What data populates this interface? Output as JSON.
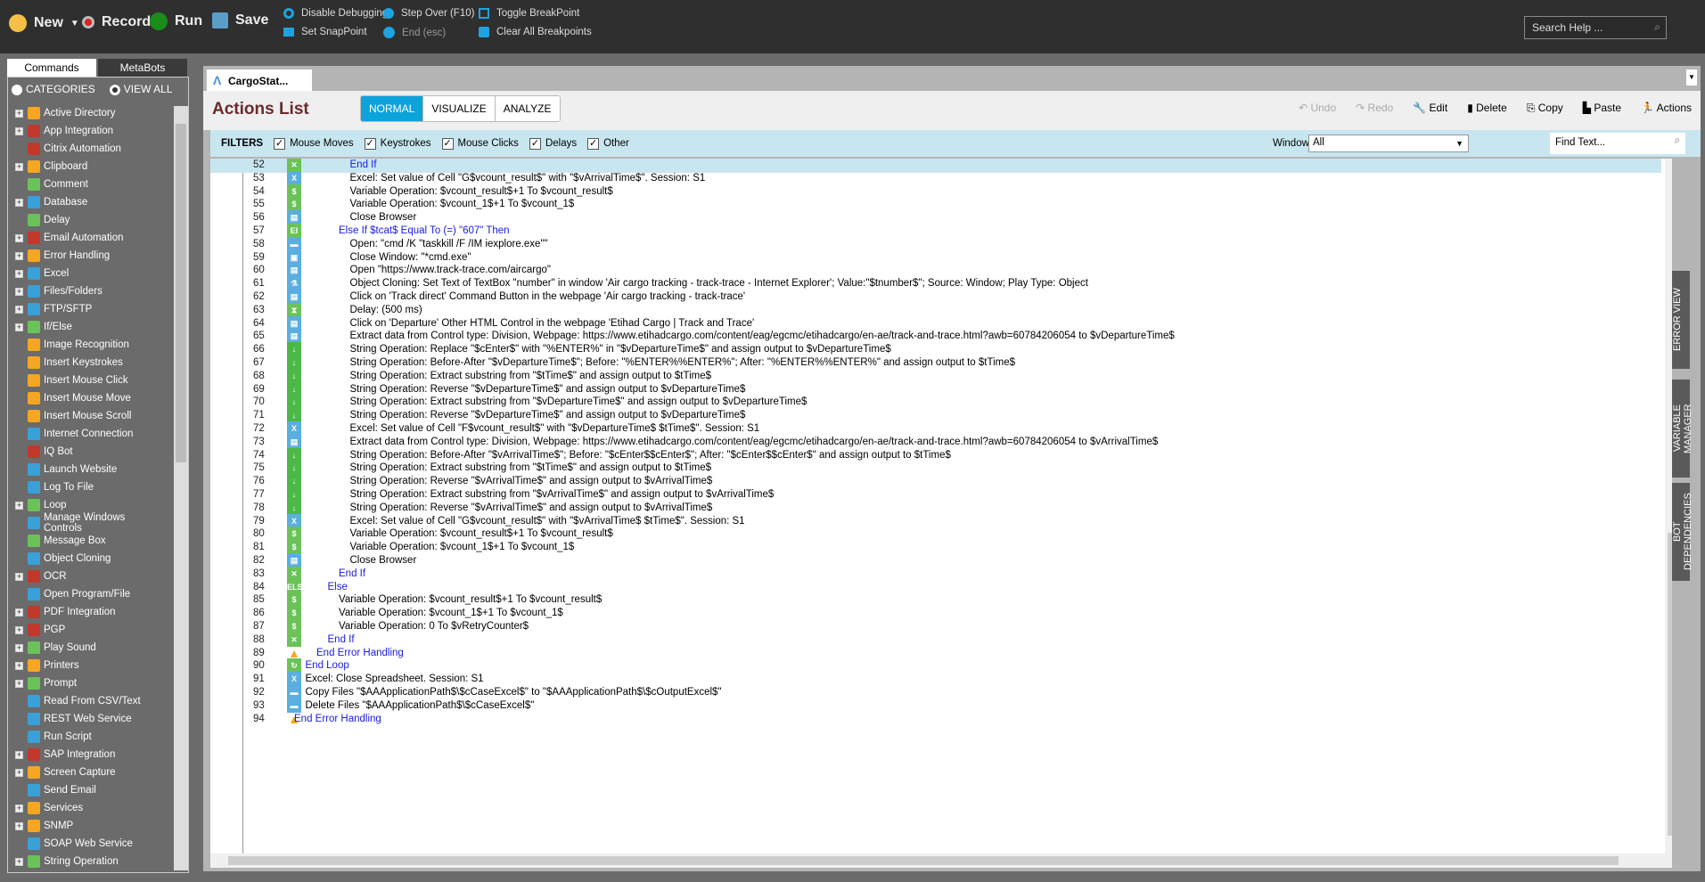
{
  "toolbar": {
    "new": "New",
    "record": "Record",
    "run": "Run",
    "save": "Save",
    "disable_debugging": "Disable Debugging",
    "set_snappoint": "Set SnapPoint",
    "step_over": "Step Over (F10)",
    "end": "End (esc)",
    "toggle_breakpoint": "Toggle BreakPoint",
    "clear_breakpoints": "Clear All Breakpoints",
    "search_placeholder": "Search Help ..."
  },
  "left": {
    "tabs": [
      "Commands",
      "MetaBots"
    ],
    "radio_categories": "CATEGORIES",
    "radio_viewall": "VIEW ALL",
    "commands": [
      {
        "label": "Active Directory",
        "color": "#f5a623",
        "exp": true
      },
      {
        "label": "App Integration",
        "color": "#c0392b",
        "exp": true
      },
      {
        "label": "Citrix Automation",
        "color": "#c0392b",
        "exp": false
      },
      {
        "label": "Clipboard",
        "color": "#f5a623",
        "exp": true
      },
      {
        "label": "Comment",
        "color": "#6ac259",
        "exp": false
      },
      {
        "label": "Database",
        "color": "#3aa0d8",
        "exp": true
      },
      {
        "label": "Delay",
        "color": "#6ac259",
        "exp": false
      },
      {
        "label": "Email Automation",
        "color": "#c0392b",
        "exp": true
      },
      {
        "label": "Error Handling",
        "color": "#f5a623",
        "exp": true
      },
      {
        "label": "Excel",
        "color": "#3aa0d8",
        "exp": true
      },
      {
        "label": "Files/Folders",
        "color": "#3aa0d8",
        "exp": true
      },
      {
        "label": "FTP/SFTP",
        "color": "#3aa0d8",
        "exp": true
      },
      {
        "label": "If/Else",
        "color": "#6ac259",
        "exp": true
      },
      {
        "label": "Image Recognition",
        "color": "#f5a623",
        "exp": false
      },
      {
        "label": "Insert Keystrokes",
        "color": "#f5a623",
        "exp": false
      },
      {
        "label": "Insert Mouse Click",
        "color": "#f5a623",
        "exp": false
      },
      {
        "label": "Insert Mouse Move",
        "color": "#f5a623",
        "exp": false
      },
      {
        "label": "Insert Mouse Scroll",
        "color": "#f5a623",
        "exp": false
      },
      {
        "label": "Internet Connection",
        "color": "#3aa0d8",
        "exp": false
      },
      {
        "label": "IQ Bot",
        "color": "#c0392b",
        "exp": false
      },
      {
        "label": "Launch Website",
        "color": "#3aa0d8",
        "exp": false
      },
      {
        "label": "Log To File",
        "color": "#3aa0d8",
        "exp": false
      },
      {
        "label": "Loop",
        "color": "#6ac259",
        "exp": true
      },
      {
        "label": "Manage Windows Controls",
        "color": "#3aa0d8",
        "exp": false
      },
      {
        "label": "Message Box",
        "color": "#6ac259",
        "exp": false
      },
      {
        "label": "Object Cloning",
        "color": "#3aa0d8",
        "exp": false
      },
      {
        "label": "OCR",
        "color": "#c0392b",
        "exp": true
      },
      {
        "label": "Open Program/File",
        "color": "#3aa0d8",
        "exp": false
      },
      {
        "label": "PDF Integration",
        "color": "#c0392b",
        "exp": true
      },
      {
        "label": "PGP",
        "color": "#c0392b",
        "exp": true
      },
      {
        "label": "Play Sound",
        "color": "#6ac259",
        "exp": true
      },
      {
        "label": "Printers",
        "color": "#f5a623",
        "exp": true
      },
      {
        "label": "Prompt",
        "color": "#6ac259",
        "exp": true
      },
      {
        "label": "Read From CSV/Text",
        "color": "#3aa0d8",
        "exp": false
      },
      {
        "label": "REST Web Service",
        "color": "#3aa0d8",
        "exp": false
      },
      {
        "label": "Run Script",
        "color": "#3aa0d8",
        "exp": false
      },
      {
        "label": "SAP Integration",
        "color": "#c0392b",
        "exp": true
      },
      {
        "label": "Screen Capture",
        "color": "#f5a623",
        "exp": true
      },
      {
        "label": "Send Email",
        "color": "#3aa0d8",
        "exp": false
      },
      {
        "label": "Services",
        "color": "#f5a623",
        "exp": true
      },
      {
        "label": "SNMP",
        "color": "#f5a623",
        "exp": true
      },
      {
        "label": "SOAP Web Service",
        "color": "#3aa0d8",
        "exp": false
      },
      {
        "label": "String Operation",
        "color": "#6ac259",
        "exp": true
      }
    ]
  },
  "doc_tab": "CargoStat...",
  "header": {
    "title": "Actions List",
    "views": [
      "NORMAL",
      "VISUALIZE",
      "ANALYZE"
    ],
    "actions": {
      "undo": "Undo",
      "redo": "Redo",
      "edit": "Edit",
      "delete": "Delete",
      "copy": "Copy",
      "paste": "Paste",
      "actions": "Actions"
    }
  },
  "filters": {
    "label": "FILTERS",
    "items": [
      "Mouse Moves",
      "Keystrokes",
      "Mouse Clicks",
      "Delays",
      "Other"
    ],
    "windows_label": "Windows",
    "windows_value": "All",
    "find_placeholder": "Find Text..."
  },
  "side_tabs": [
    "ERROR VIEW",
    "VARIABLE MANAGER",
    "BOT DEPENDENCIES"
  ],
  "rows": [
    {
      "n": 52,
      "lvl": 5,
      "icon": "endif",
      "blue": true,
      "t": "End If"
    },
    {
      "n": 53,
      "lvl": 5,
      "icon": "excel",
      "t": "Excel: Set value of Cell \"G$vcount_result$\" with \"$vArrivalTime$\". Session: S1"
    },
    {
      "n": 54,
      "lvl": 5,
      "icon": "var",
      "t": "Variable Operation: $vcount_result$+1 To $vcount_result$"
    },
    {
      "n": 55,
      "lvl": 5,
      "icon": "var",
      "t": "Variable Operation: $vcount_1$+1 To $vcount_1$"
    },
    {
      "n": 56,
      "lvl": 5,
      "icon": "web",
      "t": "Close Browser"
    },
    {
      "n": 57,
      "lvl": 4,
      "icon": "elseif",
      "blue": true,
      "t": "Else If $tcat$ Equal To (=) \"607\" Then"
    },
    {
      "n": 58,
      "lvl": 5,
      "icon": "folder",
      "t": "Open: \"cmd /K \"taskkill /F /IM iexplore.exe\"\""
    },
    {
      "n": 59,
      "lvl": 5,
      "icon": "window",
      "t": "Close Window: \"*cmd.exe\""
    },
    {
      "n": 60,
      "lvl": 5,
      "icon": "web",
      "t": "Open \"https://www.track-trace.com/aircargo\""
    },
    {
      "n": 61,
      "lvl": 5,
      "icon": "clone",
      "t": "Object Cloning: Set Text of TextBox \"number\" in window 'Air cargo tracking - track-trace - Internet Explorer'; Value:\"$tnumber$\"; Source: Window; Play Type: Object"
    },
    {
      "n": 62,
      "lvl": 5,
      "icon": "web",
      "t": "Click on 'Track direct' Command Button in the webpage 'Air cargo tracking - track-trace'"
    },
    {
      "n": 63,
      "lvl": 5,
      "icon": "delay",
      "t": "Delay: (500 ms)"
    },
    {
      "n": 64,
      "lvl": 5,
      "icon": "web",
      "t": "Click on 'Departure' Other HTML Control in the webpage 'Etihad Cargo | Track and Trace'"
    },
    {
      "n": 65,
      "lvl": 5,
      "icon": "web",
      "t": "Extract data from Control type: Division, Webpage: https://www.etihadcargo.com/content/eag/egcmc/etihadcargo/en-ae/track-and-trace.html?awb=60784206054 to $vDepartureTime$"
    },
    {
      "n": 66,
      "lvl": 5,
      "icon": "str",
      "t": "String Operation: Replace \"$cEnter$\" with \"%ENTER%\" in \"$vDepartureTime$\" and assign output to $vDepartureTime$"
    },
    {
      "n": 67,
      "lvl": 5,
      "icon": "str",
      "t": "String Operation: Before-After \"$vDepartureTime$\"; Before: \"%ENTER%%ENTER%\"; After: \"%ENTER%%ENTER%\" and assign output to $tTime$"
    },
    {
      "n": 68,
      "lvl": 5,
      "icon": "str",
      "t": "String Operation: Extract substring from \"$tTime$\" and assign output to $tTime$"
    },
    {
      "n": 69,
      "lvl": 5,
      "icon": "str",
      "t": "String Operation: Reverse \"$vDepartureTime$\" and assign output to $vDepartureTime$"
    },
    {
      "n": 70,
      "lvl": 5,
      "icon": "str",
      "t": "String Operation: Extract substring from \"$vDepartureTime$\" and assign output to $vDepartureTime$"
    },
    {
      "n": 71,
      "lvl": 5,
      "icon": "str",
      "t": "String Operation: Reverse \"$vDepartureTime$\" and assign output to $vDepartureTime$"
    },
    {
      "n": 72,
      "lvl": 5,
      "icon": "excel",
      "t": "Excel: Set value of Cell \"F$vcount_result$\" with \"$vDepartureTime$ $tTime$\". Session: S1"
    },
    {
      "n": 73,
      "lvl": 5,
      "icon": "web",
      "t": "Extract data from Control type: Division, Webpage: https://www.etihadcargo.com/content/eag/egcmc/etihadcargo/en-ae/track-and-trace.html?awb=60784206054 to $vArrivalTime$"
    },
    {
      "n": 74,
      "lvl": 5,
      "icon": "str",
      "t": "String Operation: Before-After \"$vArrivalTime$\"; Before: \"$cEnter$$cEnter$\"; After: \"$cEnter$$cEnter$\" and assign output to $tTime$"
    },
    {
      "n": 75,
      "lvl": 5,
      "icon": "str",
      "t": "String Operation: Extract substring from \"$tTime$\" and assign output to $tTime$"
    },
    {
      "n": 76,
      "lvl": 5,
      "icon": "str",
      "t": "String Operation: Reverse \"$vArrivalTime$\" and assign output to $vArrivalTime$"
    },
    {
      "n": 77,
      "lvl": 5,
      "icon": "str",
      "t": "String Operation: Extract substring from \"$vArrivalTime$\" and assign output to $vArrivalTime$"
    },
    {
      "n": 78,
      "lvl": 5,
      "icon": "str",
      "t": "String Operation: Reverse \"$vArrivalTime$\" and assign output to $vArrivalTime$"
    },
    {
      "n": 79,
      "lvl": 5,
      "icon": "excel",
      "t": "Excel: Set value of Cell \"G$vcount_result$\" with \"$vArrivalTime$ $tTime$\". Session: S1"
    },
    {
      "n": 80,
      "lvl": 5,
      "icon": "var",
      "t": "Variable Operation: $vcount_result$+1 To $vcount_result$"
    },
    {
      "n": 81,
      "lvl": 5,
      "icon": "var",
      "t": "Variable Operation: $vcount_1$+1 To $vcount_1$"
    },
    {
      "n": 82,
      "lvl": 5,
      "icon": "web",
      "t": "Close Browser"
    },
    {
      "n": 83,
      "lvl": 4,
      "icon": "endif",
      "blue": true,
      "t": "End If"
    },
    {
      "n": 84,
      "lvl": 3,
      "icon": "else",
      "blue": true,
      "t": "Else"
    },
    {
      "n": 85,
      "lvl": 4,
      "icon": "var",
      "t": "Variable Operation: $vcount_result$+1 To $vcount_result$"
    },
    {
      "n": 86,
      "lvl": 4,
      "icon": "var",
      "t": "Variable Operation: $vcount_1$+1 To $vcount_1$"
    },
    {
      "n": 87,
      "lvl": 4,
      "icon": "var",
      "t": "Variable Operation: 0 To $vRetryCounter$"
    },
    {
      "n": 88,
      "lvl": 3,
      "icon": "endif",
      "blue": true,
      "t": "End If"
    },
    {
      "n": 89,
      "lvl": 2,
      "icon": "error",
      "blue": true,
      "t": "End Error Handling"
    },
    {
      "n": 90,
      "lvl": 1,
      "icon": "loop",
      "blue": true,
      "t": "End Loop"
    },
    {
      "n": 91,
      "lvl": 1,
      "icon": "excel",
      "t": "Excel: Close Spreadsheet. Session: S1"
    },
    {
      "n": 92,
      "lvl": 1,
      "icon": "folder",
      "t": "Copy Files \"$AAApplicationPath$\\$cCaseExcel$\" to \"$AAApplicationPath$\\$cOutputExcel$\""
    },
    {
      "n": 93,
      "lvl": 1,
      "icon": "folder",
      "t": "Delete Files \"$AAApplicationPath$\\$cCaseExcel$\""
    },
    {
      "n": 94,
      "lvl": 0,
      "icon": "error",
      "blue": true,
      "t": "End Error Handling"
    }
  ],
  "icon_styles": {
    "endif": {
      "bg": "#6ac259",
      "g": "✕"
    },
    "excel": {
      "bg": "#5aaee0",
      "g": "X"
    },
    "var": {
      "bg": "#6ac259",
      "g": "$"
    },
    "web": {
      "bg": "#5aaee0",
      "g": "▤"
    },
    "elseif": {
      "bg": "#6ac259",
      "g": "EI"
    },
    "else": {
      "bg": "#6ac259",
      "g": "ELSE"
    },
    "folder": {
      "bg": "#5aaee0",
      "g": "▬"
    },
    "window": {
      "bg": "#5aaee0",
      "g": "▣"
    },
    "clone": {
      "bg": "#5aaee0",
      "g": "⚗"
    },
    "delay": {
      "bg": "#6ac259",
      "g": "⧗"
    },
    "str": {
      "bg": "#4cb848",
      "g": "↓"
    },
    "error": {
      "bg": "#f5a623",
      "g": "!"
    },
    "loop": {
      "bg": "#6ac259",
      "g": "↻"
    }
  },
  "selected_line": 52
}
